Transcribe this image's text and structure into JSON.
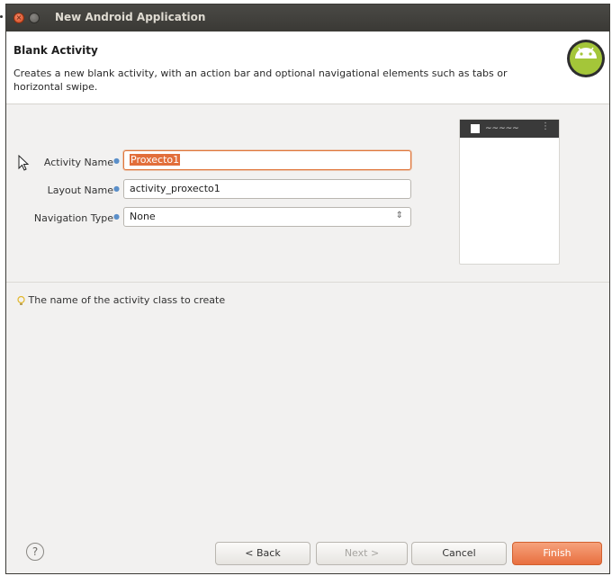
{
  "window": {
    "title": "New Android Application"
  },
  "header": {
    "title": "Blank Activity",
    "description": "Creates a new blank activity, with an action bar and optional navigational elements such as tabs or horizontal swipe."
  },
  "form": {
    "activity_name_label": "Activity Name",
    "activity_name_value": "Proxecto1",
    "layout_name_label": "Layout Name",
    "layout_name_value": "activity_proxecto1",
    "navigation_type_label": "Navigation Type",
    "navigation_type_value": "None"
  },
  "hint": {
    "text": "The name of the activity class to create"
  },
  "buttons": {
    "back": "< Back",
    "next": "Next >",
    "cancel": "Cancel",
    "finish": "Finish"
  },
  "icons": {
    "help": "help-icon",
    "hint": "lightbulb-icon",
    "logo": "android-logo"
  },
  "colors": {
    "accent": "#e86f3f",
    "titlebar": "#3c3b37"
  }
}
